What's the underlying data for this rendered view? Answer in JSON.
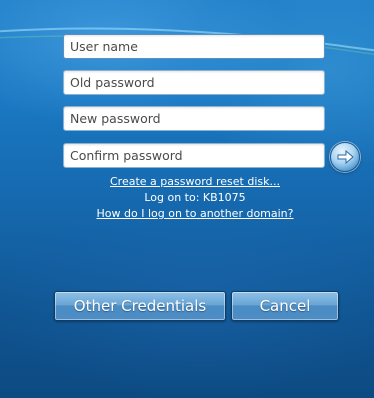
{
  "form": {
    "username_placeholder": "User name",
    "old_password_placeholder": "Old password",
    "new_password_placeholder": "New password",
    "confirm_password_placeholder": "Confirm password",
    "submit_icon": "arrow-right-icon"
  },
  "links": {
    "reset_disk": "Create a password reset disk...",
    "logon_to": "Log on to: KB1075",
    "other_domain": "How do I log on to another domain?"
  },
  "buttons": {
    "other_credentials": "Other Credentials",
    "cancel": "Cancel"
  },
  "colors": {
    "background": "#1a6fb8",
    "button": "#5f9bd0",
    "link": "#ffffff"
  }
}
